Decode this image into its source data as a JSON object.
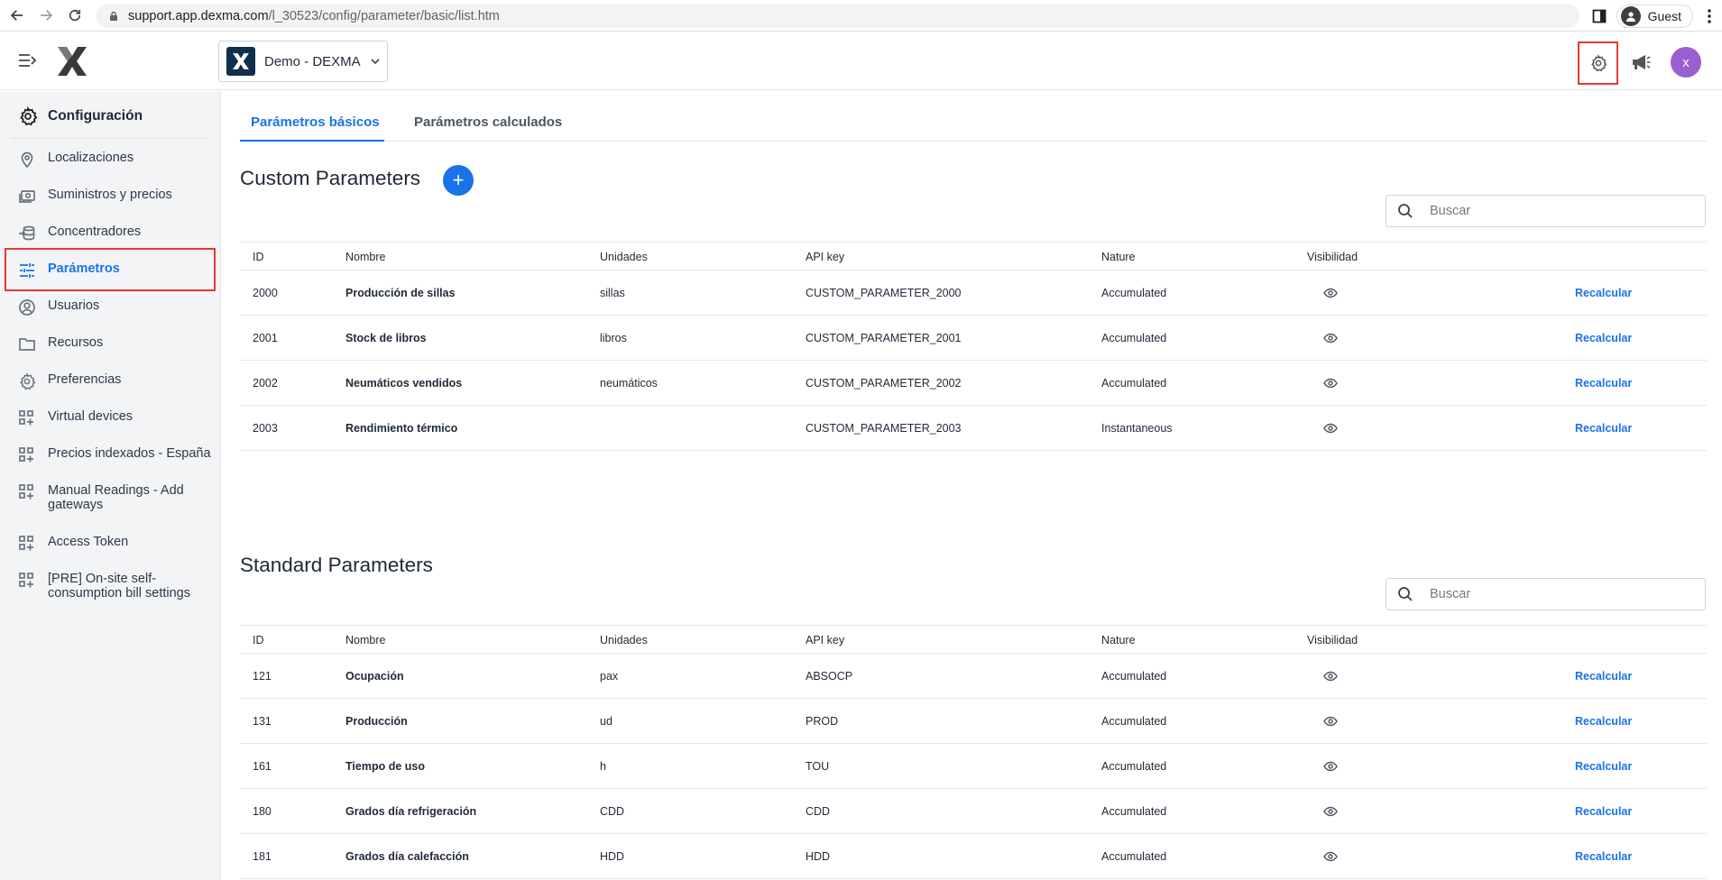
{
  "browser": {
    "url_host": "support.app.dexma.com",
    "url_path": "/l_30523/config/parameter/basic/list.htm",
    "profile_label": "Guest"
  },
  "header": {
    "org_name": "Demo - DEXMA",
    "avatar_initial": "x",
    "icons": [
      "menu-toggle-icon",
      "dexma-logo",
      "gear-icon",
      "megaphone-icon"
    ],
    "colors": {
      "accent": "#1a73e8",
      "avatar": "#9c5fd1",
      "highlight": "#e53935"
    }
  },
  "sidebar": {
    "title": "Configuración",
    "items": [
      {
        "label": "Localizaciones",
        "icon": "location-pin-icon"
      },
      {
        "label": "Suministros y precios",
        "icon": "money-icon"
      },
      {
        "label": "Concentradores",
        "icon": "database-icon"
      },
      {
        "label": "Parámetros",
        "icon": "sliders-icon",
        "active": true
      },
      {
        "label": "Usuarios",
        "icon": "user-circle-icon"
      },
      {
        "label": "Recursos",
        "icon": "folder-icon"
      },
      {
        "label": "Preferencias",
        "icon": "gear-icon"
      },
      {
        "label": "Virtual devices",
        "icon": "apps-add-icon"
      },
      {
        "label": "Precios indexados - España",
        "icon": "apps-add-icon"
      },
      {
        "label": "Manual Readings - Add gateways",
        "icon": "apps-add-icon"
      },
      {
        "label": "Access Token",
        "icon": "apps-add-icon"
      },
      {
        "label": "[PRE] On-site self-consumption bill settings",
        "icon": "apps-add-icon"
      }
    ]
  },
  "tabs": [
    {
      "label": "Parámetros básicos",
      "active": true
    },
    {
      "label": "Parámetros calculados",
      "active": false
    }
  ],
  "columns": {
    "id": "ID",
    "name": "Nombre",
    "units": "Unidades",
    "api": "API key",
    "nature": "Nature",
    "visibility": "Visibilidad"
  },
  "custom": {
    "title": "Custom Parameters",
    "add_label": "+",
    "search_placeholder": "Buscar",
    "rows": [
      {
        "id": "2000",
        "name": "Producción de sillas",
        "units": "sillas",
        "api": "CUSTOM_PARAMETER_2000",
        "nature": "Accumulated",
        "action": "Recalcular"
      },
      {
        "id": "2001",
        "name": "Stock de libros",
        "units": "libros",
        "api": "CUSTOM_PARAMETER_2001",
        "nature": "Accumulated",
        "action": "Recalcular"
      },
      {
        "id": "2002",
        "name": "Neumáticos vendidos",
        "units": "neumáticos",
        "api": "CUSTOM_PARAMETER_2002",
        "nature": "Accumulated",
        "action": "Recalcular"
      },
      {
        "id": "2003",
        "name": "Rendimiento térmico",
        "units": "",
        "api": "CUSTOM_PARAMETER_2003",
        "nature": "Instantaneous",
        "action": "Recalcular"
      }
    ]
  },
  "standard": {
    "title": "Standard Parameters",
    "search_placeholder": "Buscar",
    "rows": [
      {
        "id": "121",
        "name": "Ocupación",
        "units": "pax",
        "api": "ABSOCP",
        "nature": "Accumulated",
        "action": "Recalcular"
      },
      {
        "id": "131",
        "name": "Producción",
        "units": "ud",
        "api": "PROD",
        "nature": "Accumulated",
        "action": "Recalcular"
      },
      {
        "id": "161",
        "name": "Tiempo de uso",
        "units": "h",
        "api": "TOU",
        "nature": "Accumulated",
        "action": "Recalcular"
      },
      {
        "id": "180",
        "name": "Grados día refrigeración",
        "units": "CDD",
        "api": "CDD",
        "nature": "Accumulated",
        "action": "Recalcular"
      },
      {
        "id": "181",
        "name": "Grados día calefacción",
        "units": "HDD",
        "api": "HDD",
        "nature": "Accumulated",
        "action": "Recalcular"
      }
    ]
  }
}
